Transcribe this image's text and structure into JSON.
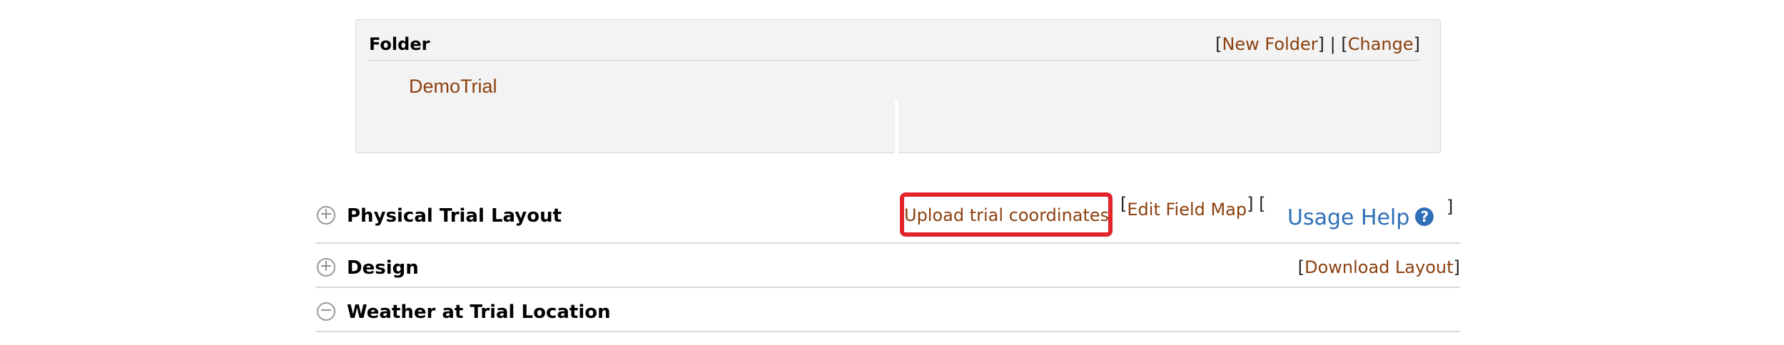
{
  "folder": {
    "title": "Folder",
    "new_folder_label": "New Folder",
    "change_label": "Change",
    "separator": "|",
    "item": "DemoTrial"
  },
  "sections": {
    "layout": {
      "toggle": "+",
      "title": "Physical Trial Layout",
      "upload_label": "Upload trial coordinates",
      "edit_field_map_label": "Edit Field Map",
      "usage_help_label": "Usage Help",
      "help_icon_glyph": "?"
    },
    "design": {
      "toggle": "+",
      "title": "Design",
      "download_label": "Download Layout"
    },
    "weather": {
      "toggle": "−",
      "title": "Weather at Trial Location"
    }
  },
  "colors": {
    "link": "#8b3f0d",
    "help": "#2f6fb7",
    "highlight": "#e3242b"
  }
}
